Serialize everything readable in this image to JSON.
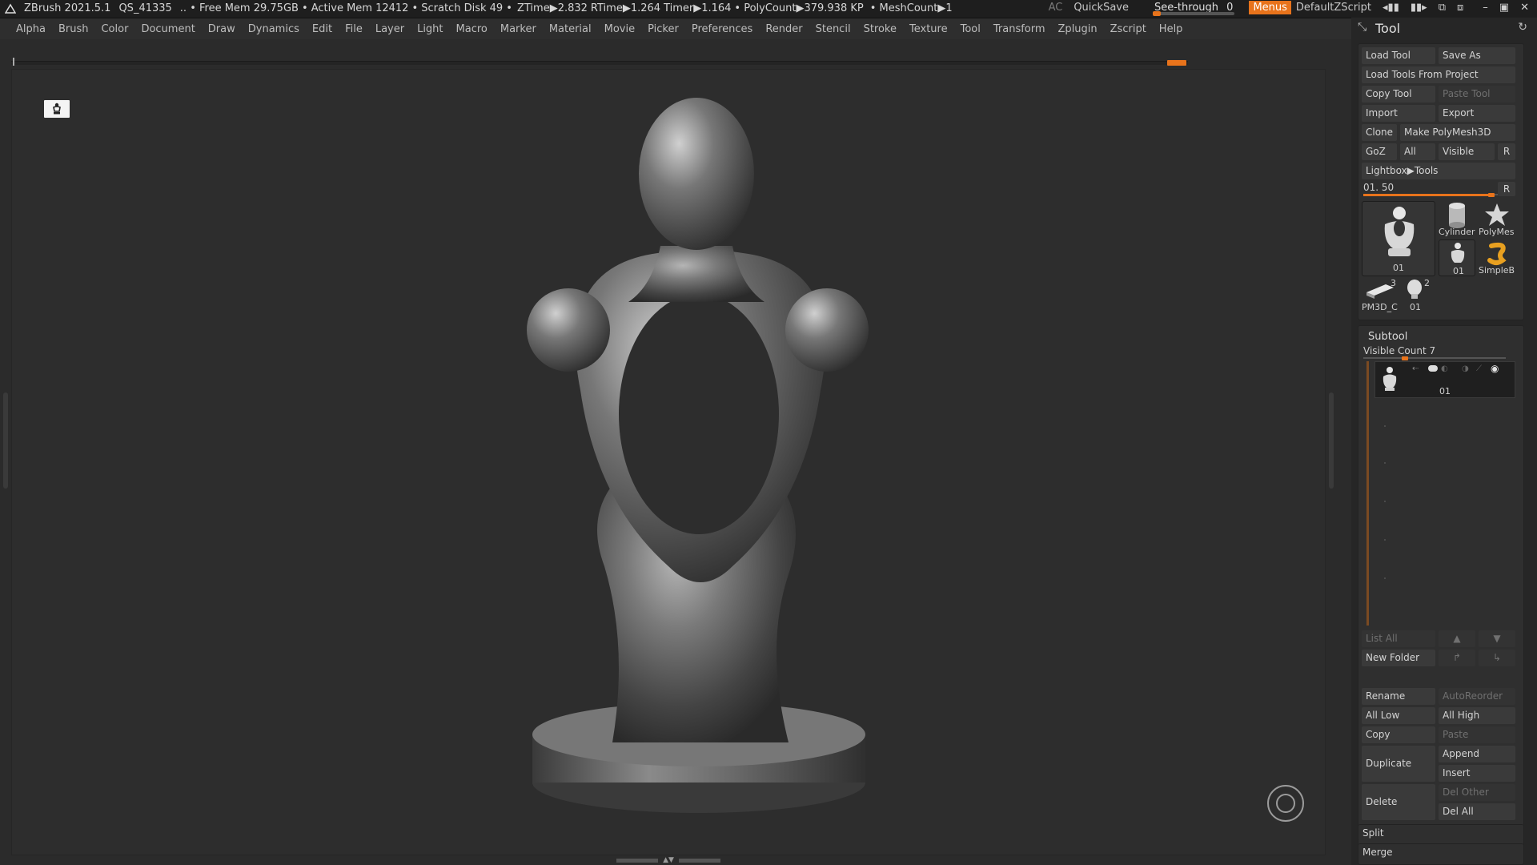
{
  "titlebar": {
    "app": "ZBrush 2021.5.1",
    "doc": "QS_41335",
    "free_mem": ".. • Free Mem 29.75GB",
    "active_mem": "• Active Mem 12412",
    "scratch": "• Scratch Disk 49 •",
    "ztime": "ZTime▶2.832",
    "rtime": "RTime▶1.264",
    "timer": "Timer▶1.164",
    "polycount": "• PolyCount▶379.938 KP",
    "meshcount": "• MeshCount▶1",
    "ac": "AC",
    "quicksave": "QuickSave",
    "seethrough_label": "See-through",
    "seethrough_value": "0",
    "seethrough_level": 0,
    "menus": "Menus",
    "script": "DefaultZScript"
  },
  "menubar": [
    "Alpha",
    "Brush",
    "Color",
    "Document",
    "Draw",
    "Dynamics",
    "Edit",
    "File",
    "Layer",
    "Light",
    "Macro",
    "Marker",
    "Material",
    "Movie",
    "Picker",
    "Preferences",
    "Render",
    "Stencil",
    "Stroke",
    "Texture",
    "Tool",
    "Transform",
    "Zplugin",
    "Zscript",
    "Help"
  ],
  "tool": {
    "title": "Tool",
    "load_tool": "Load Tool",
    "save_as": "Save As",
    "load_from_project": "Load Tools From Project",
    "copy_tool": "Copy Tool",
    "paste_tool": "Paste Tool",
    "import": "Import",
    "export": "Export",
    "clone": "Clone",
    "make_polymesh": "Make PolyMesh3D",
    "goz": "GoZ",
    "all": "All",
    "visible": "Visible",
    "r": "R",
    "lightbox": "Lightbox▶Tools",
    "slider_label": "01. 50",
    "slider_level": 0.94,
    "thumbs": {
      "main": "01",
      "cylinder": "Cylinder",
      "polymesh": "PolyMes",
      "small_01": "01",
      "simpleb": "SimpleB",
      "pm3d": "PM3D_C",
      "pm3d_count": "3",
      "head": "01",
      "head_count": "2"
    }
  },
  "subtool": {
    "title": "Subtool",
    "visible_count": "Visible Count 7",
    "item_name": "01",
    "list_all": "List All",
    "new_folder": "New Folder",
    "rename": "Rename",
    "autoreorder": "AutoReorder",
    "all_low": "All Low",
    "all_high": "All High",
    "copy": "Copy",
    "paste": "Paste",
    "duplicate": "Duplicate",
    "append": "Append",
    "insert": "Insert",
    "delete": "Delete",
    "del_other": "Del Other",
    "del_all": "Del All",
    "split": "Split",
    "merge": "Merge"
  },
  "colors": {
    "accent": "#e8731b",
    "background": "#2b2b2b",
    "panel": "#262626",
    "button": "#3a3a3a"
  }
}
